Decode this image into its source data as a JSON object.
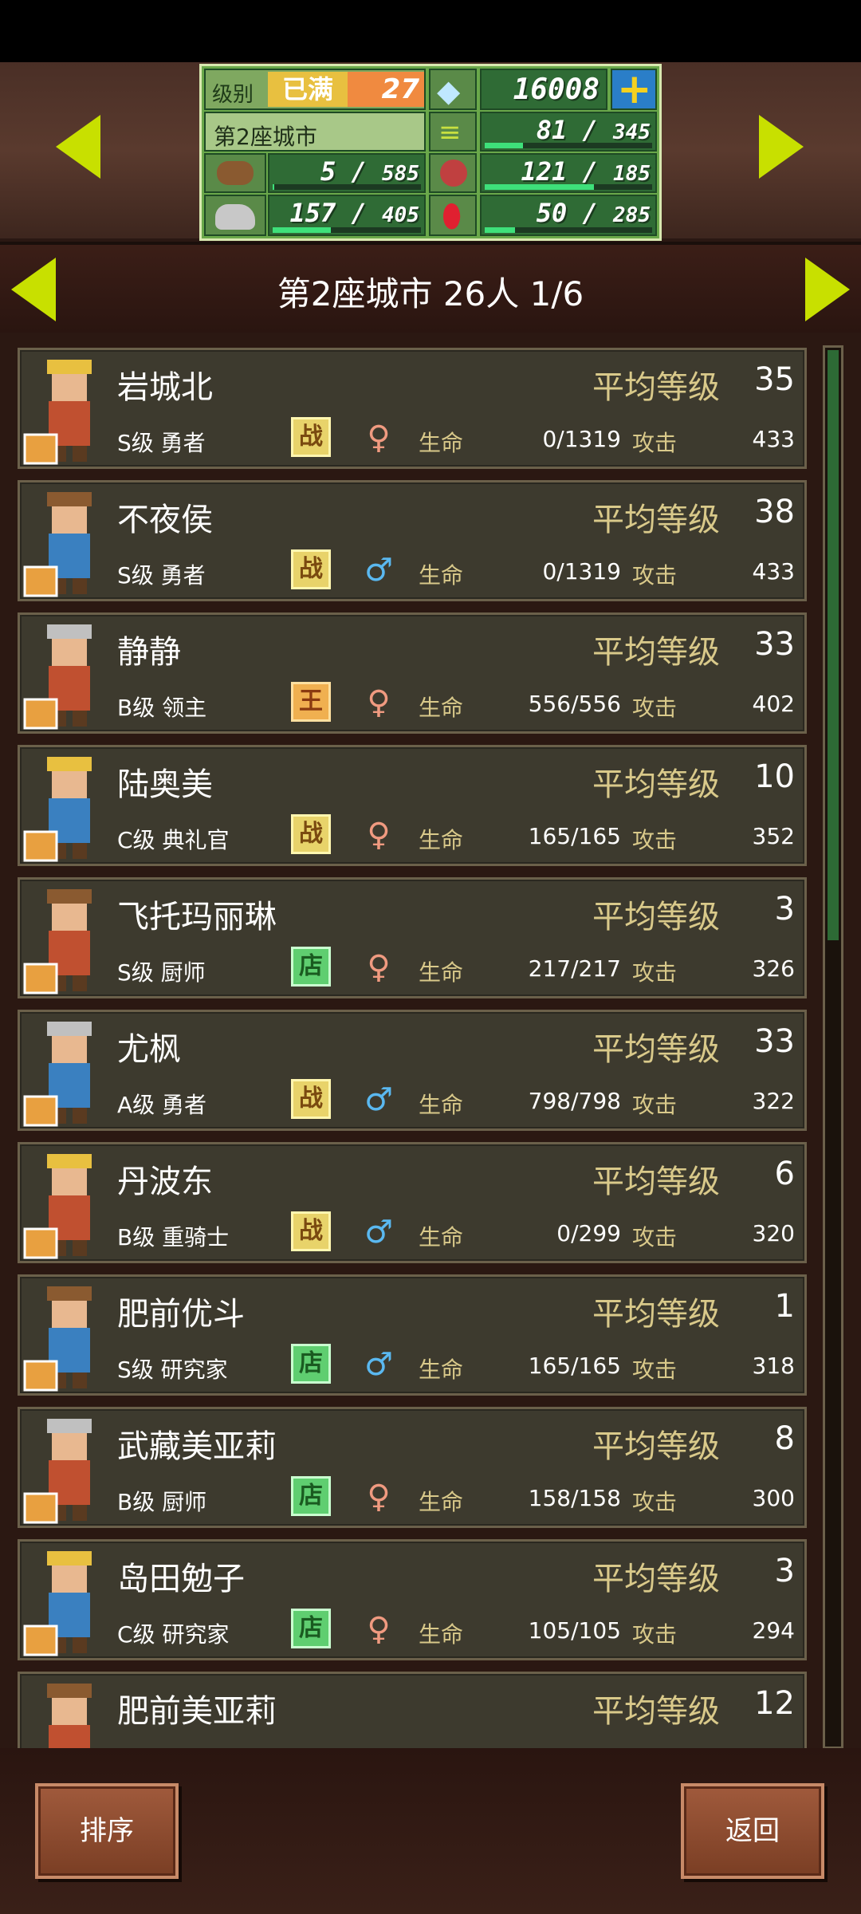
{
  "hud": {
    "level_label": "级别",
    "level_max": "已满",
    "level_value": "27",
    "gems": "16008",
    "city_name": "第2座城市",
    "resources": [
      {
        "icon": "wood-icon",
        "value": "5",
        "max": "585",
        "fraction": 0.01
      },
      {
        "icon": "stone-icon",
        "value": "157",
        "max": "405",
        "fraction": 0.39
      },
      {
        "icon": "grass-icon",
        "value": "81",
        "max": "345",
        "fraction": 0.23
      },
      {
        "icon": "food-icon",
        "value": "121",
        "max": "185",
        "fraction": 0.65
      },
      {
        "icon": "ruby-icon",
        "value": "50",
        "max": "285",
        "fraction": 0.18
      }
    ]
  },
  "header": {
    "title": "第2座城市  26人 1/6"
  },
  "labels": {
    "avg_level": "平均等级",
    "hp": "生命",
    "atk": "攻击"
  },
  "rows": [
    {
      "name": "岩城北",
      "class": "S级 勇者",
      "badge": "战",
      "gender": "f",
      "hp": "0/1319",
      "atk": "433",
      "level": "35"
    },
    {
      "name": "不夜侯",
      "class": "S级 勇者",
      "badge": "战",
      "gender": "m",
      "hp": "0/1319",
      "atk": "433",
      "level": "38"
    },
    {
      "name": "静静",
      "class": "B级 领主",
      "badge": "王",
      "gender": "f",
      "hp": "556/556",
      "atk": "402",
      "level": "33"
    },
    {
      "name": "陆奥美",
      "class": "C级 典礼官",
      "badge": "战",
      "gender": "f",
      "hp": "165/165",
      "atk": "352",
      "level": "10"
    },
    {
      "name": "飞托玛丽琳",
      "class": "S级 厨师",
      "badge": "店",
      "gender": "f",
      "hp": "217/217",
      "atk": "326",
      "level": "3"
    },
    {
      "name": "尤枫",
      "class": "A级 勇者",
      "badge": "战",
      "gender": "m",
      "hp": "798/798",
      "atk": "322",
      "level": "33"
    },
    {
      "name": "丹波东",
      "class": "B级 重骑士",
      "badge": "战",
      "gender": "m",
      "hp": "0/299",
      "atk": "320",
      "level": "6"
    },
    {
      "name": "肥前优斗",
      "class": "S级 研究家",
      "badge": "店",
      "gender": "m",
      "hp": "165/165",
      "atk": "318",
      "level": "1"
    },
    {
      "name": "武藏美亚莉",
      "class": "B级 厨师",
      "badge": "店",
      "gender": "f",
      "hp": "158/158",
      "atk": "300",
      "level": "8"
    },
    {
      "name": "岛田勉子",
      "class": "C级 研究家",
      "badge": "店",
      "gender": "f",
      "hp": "105/105",
      "atk": "294",
      "level": "3"
    },
    {
      "name": "肥前美亚莉",
      "class": "",
      "badge": "",
      "gender": "",
      "hp": "",
      "atk": "",
      "level": "12"
    }
  ],
  "footer": {
    "sort_label": "排序",
    "back_label": "返回"
  },
  "colors": {
    "accent_arrow": "#c8e000",
    "panel_green": "#2f6b35",
    "bar_fill": "#3ee07a",
    "gold_text": "#d9c98a"
  }
}
